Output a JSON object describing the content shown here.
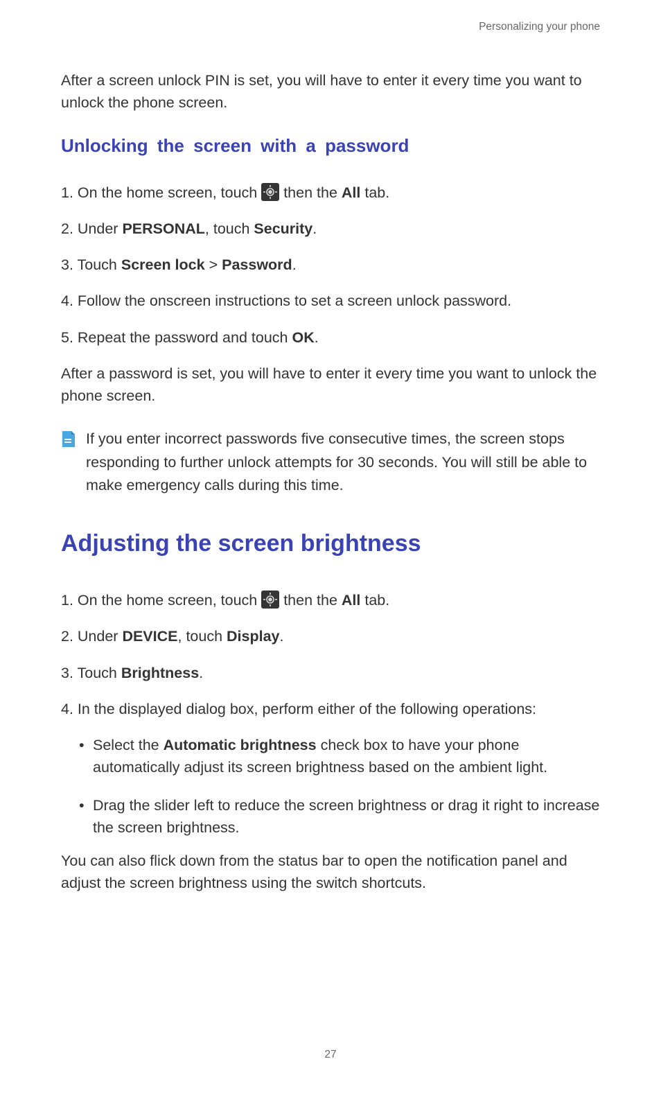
{
  "header": "Personalizing your phone",
  "intro_para": "After a screen unlock PIN is set, you will have to enter it every time you want to unlock the phone screen.",
  "sec1": {
    "title": "Unlocking the screen with a password",
    "s1_pre": "1. On the home screen, touch ",
    "s1_post_a": " then the ",
    "s1_bold": "All",
    "s1_post_b": " tab.",
    "s2_a": "2. Under ",
    "s2_b1": "PERSONAL",
    "s2_b": ", touch ",
    "s2_b2": "Security",
    "s2_c": ".",
    "s3_a": "3. Touch ",
    "s3_b1": "Screen lock",
    "s3_mid": " > ",
    "s3_b2": "Password",
    "s3_c": ".",
    "s4": "4. Follow the onscreen instructions to set a screen unlock password.",
    "s5_a": "5. Repeat the password and touch ",
    "s5_b": "OK",
    "s5_c": ".",
    "after": "After a password is set, you will have to enter it every time you want to unlock the phone screen.",
    "note": "If you enter incorrect passwords five consecutive times, the screen stops responding to further unlock attempts for 30 seconds. You will still be able to make emergency calls during this time."
  },
  "sec2": {
    "title": "Adjusting the screen brightness",
    "s1_pre": "1. On the home screen, touch ",
    "s1_post_a": " then the ",
    "s1_bold": "All",
    "s1_post_b": " tab.",
    "s2_a": "2. Under ",
    "s2_b1": "DEVICE",
    "s2_b": ", touch ",
    "s2_b2": "Display",
    "s2_c": ".",
    "s3_a": "3. Touch ",
    "s3_b1": "Brightness",
    "s3_c": ".",
    "s4": "4. In the displayed dialog box, perform either of the following operations:",
    "b1_a": "Select the ",
    "b1_b": "Automatic brightness",
    "b1_c": " check box to have your phone automatically adjust its screen brightness based on the ambient light.",
    "b2": "Drag the slider left to reduce the screen brightness or drag it right to increase the screen brightness.",
    "after": "You can also flick down from the status bar to open the notification panel and adjust the screen brightness using the switch shortcuts."
  },
  "page_number": "27"
}
